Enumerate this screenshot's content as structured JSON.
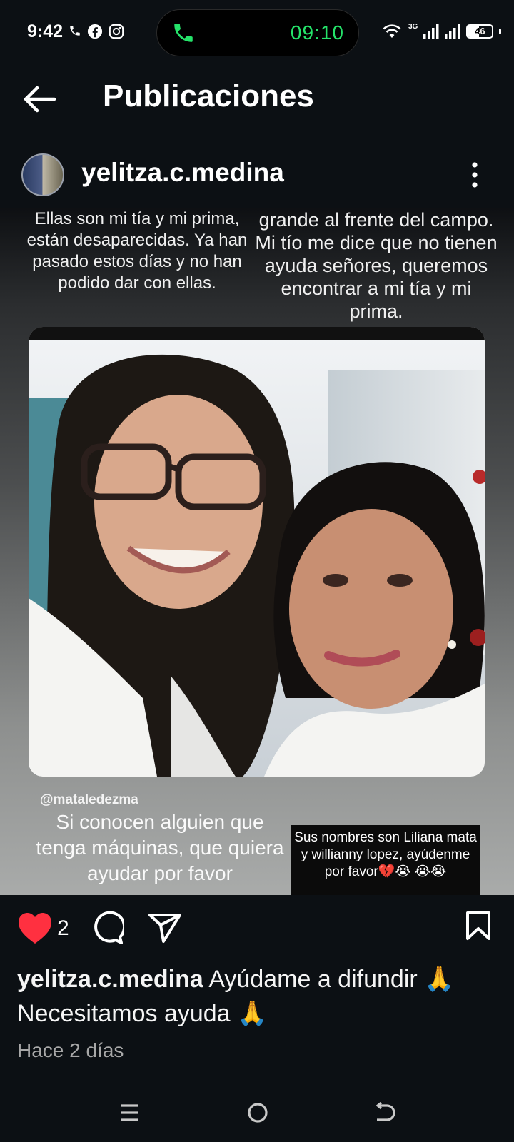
{
  "status_bar": {
    "time": "9:42",
    "call_timer": "09:10",
    "network": "3G",
    "battery": "46",
    "battery_level": 0.46,
    "call_color": "#25e36a"
  },
  "header": {
    "title": "Publicaciones"
  },
  "post": {
    "username": "yelitza.c.medina",
    "image_text": {
      "left_caption": "Ellas son mi tía y mi prima, están desaparecidas. Ya han pasado estos días y no han podido dar con ellas.",
      "right_caption": "grande al frente del campo. Mi tío me dice que no tienen ayuda señores, queremos encontrar a mi tía y mi prima.",
      "handle": "@mataledezma",
      "bottom_left": "Si conocen alguien que tenga máquinas, que quiera ayudar por favor",
      "bottom_right": "Sus nombres son Liliana mata y willianny lopez, ayúdenme por favor💔😭 😭😭"
    },
    "likes": "2",
    "caption_user": "yelitza.c.medina",
    "caption_text": "Ayúdame a difundir 🙏 Necesitamos ayuda 🙏",
    "time_ago": "Hace 2 días",
    "like_color": "#ff3040"
  },
  "icons": {
    "back": "arrow-left-icon",
    "more": "more-vertical-icon",
    "like": "heart-icon",
    "comment": "comment-icon",
    "share": "paper-plane-icon",
    "save": "bookmark-icon"
  }
}
